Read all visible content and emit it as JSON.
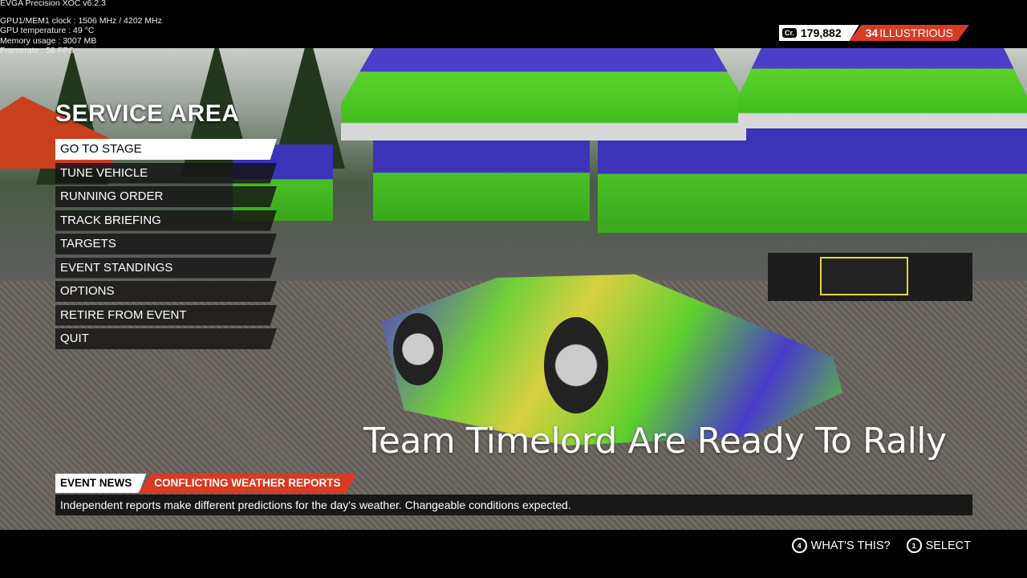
{
  "overlay": {
    "app": "EVGA Precision XOC  v6.2.3",
    "clock": "GPU1/MEM1 clock : 1506 MHz / 4202 MHz",
    "temp": "GPU temperature : 49 °C",
    "memory": "Memory usage : 3007 MB",
    "framerate": "Framerate : 58 FPS"
  },
  "hud": {
    "credits_badge": "Cr.",
    "credits": "179,882",
    "level": "34",
    "rank": "ILLUSTRIOUS",
    "accent": "#d93a22"
  },
  "title": "SERVICE AREA",
  "menu": [
    {
      "label": "GO TO STAGE"
    },
    {
      "label": "TUNE VEHICLE"
    },
    {
      "label": "RUNNING ORDER"
    },
    {
      "label": "TRACK BRIEFING"
    },
    {
      "label": "TARGETS"
    },
    {
      "label": "EVENT STANDINGS"
    },
    {
      "label": "OPTIONS"
    },
    {
      "label": "RETIRE FROM EVENT"
    },
    {
      "label": "QUIT"
    }
  ],
  "caption": "Team Timelord Are Ready To Rally",
  "news": {
    "label": "EVENT NEWS",
    "headline": "CONFLICTING WEATHER REPORTS",
    "body": "Independent reports make different predictions for the day's weather. Changeable conditions expected."
  },
  "prompts": [
    {
      "button": "4",
      "label": "WHAT'S THIS?"
    },
    {
      "button": "1",
      "label": "SELECT"
    }
  ]
}
